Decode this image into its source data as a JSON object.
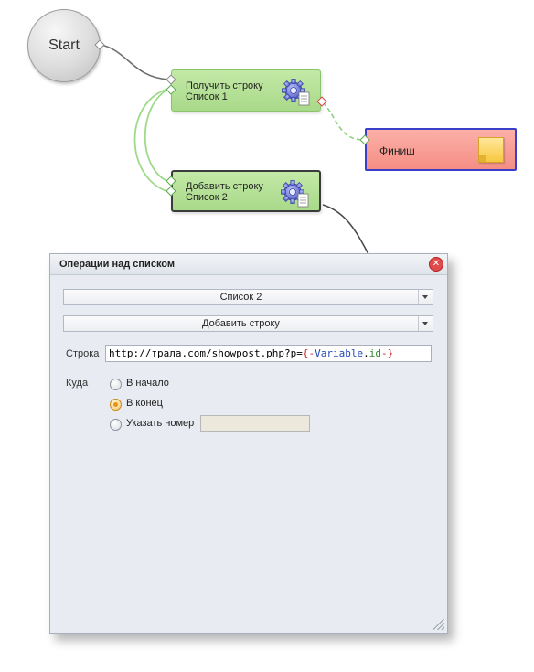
{
  "canvas": {
    "start_label": "Start",
    "node_get": {
      "line1": "Получить строку",
      "line2": "Список 1"
    },
    "node_add": {
      "line1": "Добавить строку",
      "line2": "Список 2"
    },
    "finish_label": "Финиш"
  },
  "dialog": {
    "title": "Операции над списком",
    "list_select": "Список 2",
    "operation_select": "Добавить строку",
    "string_label": "Строка",
    "string_url": "http://трала.com/showpost.php?p=",
    "string_brace_open": "{-",
    "string_var": "Variable",
    "string_dot": ".",
    "string_prop": "id",
    "string_brace_close": "-}",
    "where_label": "Куда",
    "options": [
      {
        "label": "В начало",
        "checked": false
      },
      {
        "label": "В конец",
        "checked": true
      },
      {
        "label": "Указать номер",
        "checked": false
      }
    ],
    "number_value": ""
  },
  "colors": {
    "action_node": "#b4df96",
    "finish_node": "#f79b92",
    "finish_border": "#3a3fc7",
    "dialog_bg": "#e8ebf1"
  }
}
